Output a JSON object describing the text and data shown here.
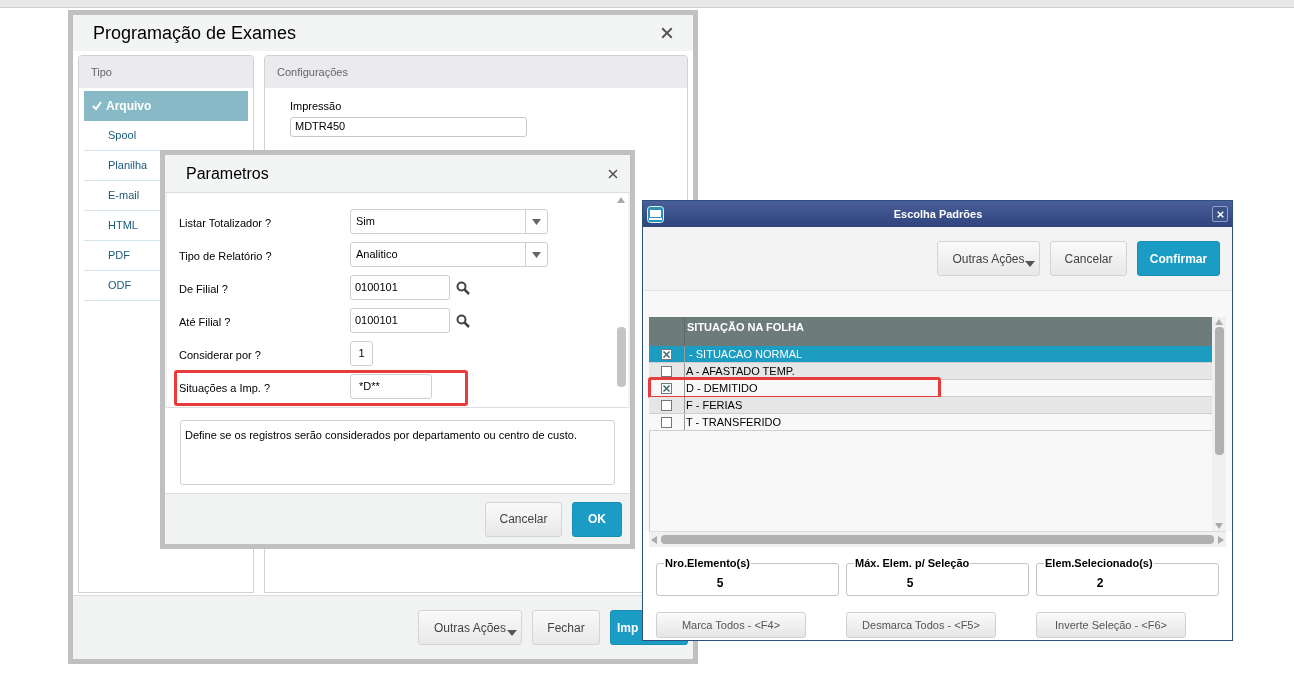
{
  "main_window": {
    "title": "Programação de Exames",
    "tipo_panel": {
      "title": "Tipo",
      "items": [
        {
          "label": "Arquivo",
          "selected": true
        },
        {
          "label": "Spool",
          "selected": false
        },
        {
          "label": "Planilha",
          "selected": false
        },
        {
          "label": "E-mail",
          "selected": false
        },
        {
          "label": "HTML",
          "selected": false
        },
        {
          "label": "PDF",
          "selected": false
        },
        {
          "label": "ODF",
          "selected": false
        }
      ]
    },
    "config_panel": {
      "title": "Configurações",
      "fields": [
        {
          "label": "Impressão",
          "value": "MDTR450"
        }
      ]
    },
    "buttons": [
      {
        "label": "Outras Ações",
        "kind": "menu"
      },
      {
        "label": "Fechar",
        "kind": "plain"
      },
      {
        "label": "Imp",
        "kind": "primary"
      }
    ]
  },
  "parametros": {
    "title": "Parametros",
    "params": [
      {
        "label": "Listar Totalizador ?",
        "kind": "select",
        "value": "Sim",
        "annotated": false
      },
      {
        "label": "Tipo de Relatório ?",
        "kind": "select",
        "value": "Analitico",
        "annotated": false
      },
      {
        "label": "De Filial ?",
        "kind": "lookup",
        "value": "0100101",
        "annotated": false
      },
      {
        "label": "Até Filial ?",
        "kind": "lookup",
        "value": "0100101",
        "annotated": false
      },
      {
        "label": "Considerar por ?",
        "kind": "short",
        "value": "1",
        "annotated": false
      },
      {
        "label": "Situações a Imp. ?",
        "kind": "text",
        "value": "*D**",
        "annotated": true
      }
    ],
    "description": "Define se os registros serão considerados por departamento ou centro de custo.",
    "buttons": [
      {
        "label": "Cancelar",
        "kind": "plain"
      },
      {
        "label": "OK",
        "kind": "primary"
      }
    ]
  },
  "escolha": {
    "title": "Escolha Padrões",
    "buttons": [
      {
        "label": "Outras Ações",
        "kind": "menu"
      },
      {
        "label": "Cancelar",
        "kind": "plain"
      },
      {
        "label": "Confirmar",
        "kind": "primary"
      }
    ],
    "column": "SITUAÇÃO NA FOLHA",
    "rows": [
      {
        "label": " - SITUACAO NORMAL",
        "checked": true,
        "selected": true,
        "annotated": false
      },
      {
        "label": "A - AFASTADO TEMP.",
        "checked": false,
        "selected": false,
        "annotated": false
      },
      {
        "label": "D - DEMITIDO",
        "checked": true,
        "selected": false,
        "annotated": true
      },
      {
        "label": "F - FERIAS",
        "checked": false,
        "selected": false,
        "annotated": false
      },
      {
        "label": "T - TRANSFERIDO",
        "checked": false,
        "selected": false,
        "annotated": false
      }
    ],
    "counters": [
      {
        "label": "Nro.Elemento(s)",
        "value": "5"
      },
      {
        "label": "Máx. Elem. p/ Seleção",
        "value": "5"
      },
      {
        "label": "Elem.Selecionado(s)",
        "value": "2"
      }
    ],
    "actions": [
      "Marca Todos - <F4>",
      "Desmarca Todos - <F5>",
      "Inverte Seleção - <F6>"
    ]
  }
}
